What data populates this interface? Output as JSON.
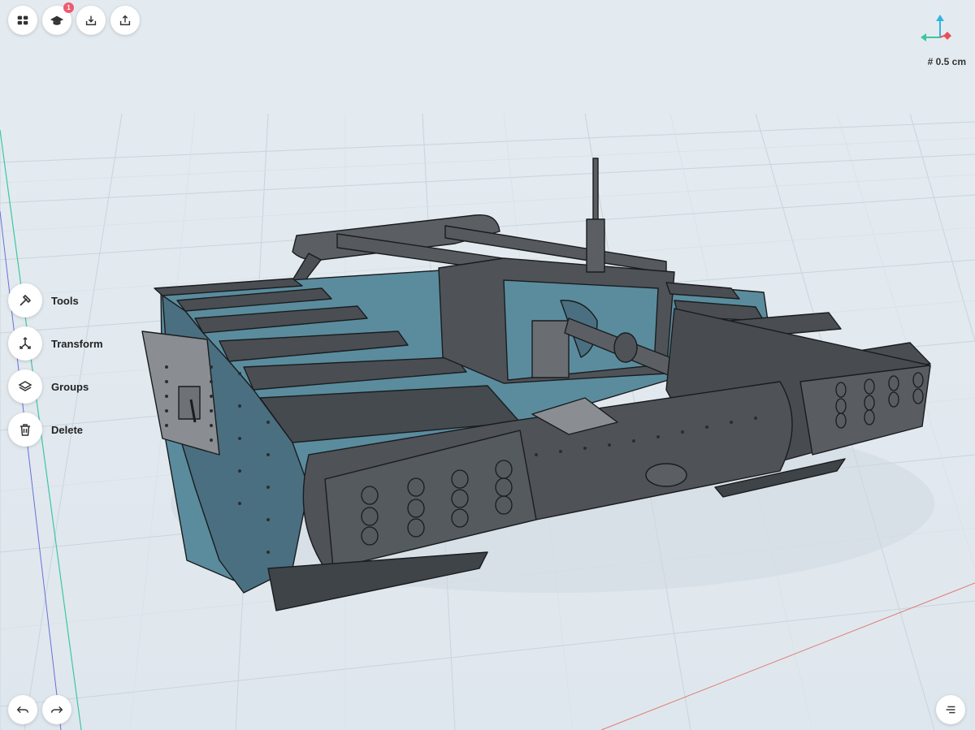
{
  "toolbar": {
    "menu_icon": "grid-icon",
    "learn_icon": "graduation-cap-icon",
    "learn_badge": "1",
    "import_icon": "import-icon",
    "export_icon": "export-icon"
  },
  "side_menu": {
    "items": [
      {
        "label": "Tools",
        "icon": "hammer-icon"
      },
      {
        "label": "Transform",
        "icon": "transform-icon"
      },
      {
        "label": "Groups",
        "icon": "layers-icon"
      },
      {
        "label": "Delete",
        "icon": "trash-icon"
      }
    ]
  },
  "viewport": {
    "grid_size": "# 0.5 cm",
    "axis_colors": {
      "x": "#e8505b",
      "y": "#3ec6a0",
      "z": "#2fb6e0"
    },
    "model_colors": {
      "body": "#3f4449",
      "plate": "#5a8c9e",
      "edge": "#1a1c1e"
    }
  },
  "bottom_bar": {
    "undo_icon": "undo-icon",
    "redo_icon": "redo-icon",
    "list_icon": "list-icon"
  }
}
